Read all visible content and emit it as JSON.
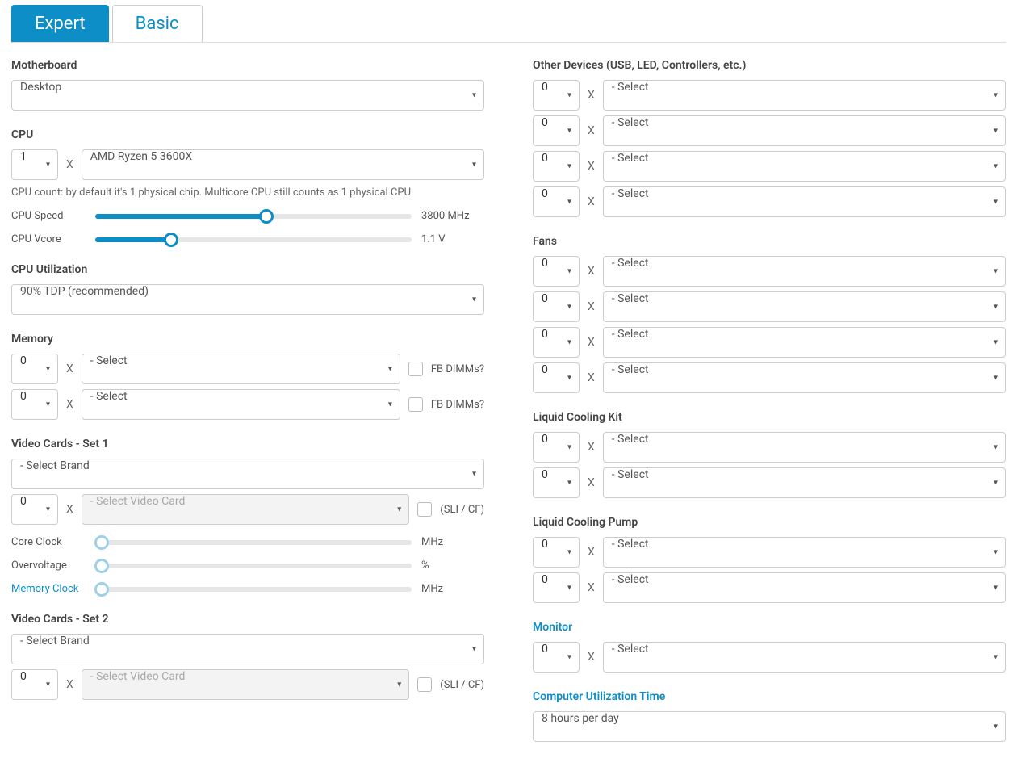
{
  "tabs": {
    "expert": "Expert",
    "basic": "Basic"
  },
  "left": {
    "motherboard": {
      "label": "Motherboard",
      "value": "Desktop"
    },
    "cpu": {
      "label": "CPU",
      "qty": "1",
      "value": "AMD Ryzen 5 3600X",
      "note": "CPU count: by default it's 1 physical chip. Multicore CPU still counts as 1 physical CPU.",
      "speed_label": "CPU Speed",
      "speed_value": "3800 MHz",
      "vcore_label": "CPU Vcore",
      "vcore_value": "1.1 V"
    },
    "cpu_util": {
      "label": "CPU Utilization",
      "value": "90% TDP (recommended)"
    },
    "memory": {
      "label": "Memory",
      "rows": [
        {
          "qty": "0",
          "value": "- Select",
          "fb": "FB DIMMs?"
        },
        {
          "qty": "0",
          "value": "- Select",
          "fb": "FB DIMMs?"
        }
      ]
    },
    "vcard1": {
      "label": "Video Cards - Set 1",
      "brand": "- Select Brand",
      "qty": "0",
      "card": "- Select Video Card",
      "sli": "(SLI / CF)",
      "core_clock_label": "Core Clock",
      "core_clock_unit": "MHz",
      "overvolt_label": "Overvoltage",
      "overvolt_unit": "%",
      "memclock_label": "Memory Clock",
      "memclock_unit": "MHz"
    },
    "vcard2": {
      "label": "Video Cards - Set 2",
      "brand": "- Select Brand",
      "qty": "0",
      "card": "- Select Video Card",
      "sli": "(SLI / CF)"
    }
  },
  "right": {
    "other": {
      "label": "Other Devices (USB, LED, Controllers, etc.)",
      "rows": [
        {
          "qty": "0",
          "value": "- Select"
        },
        {
          "qty": "0",
          "value": "- Select"
        },
        {
          "qty": "0",
          "value": "- Select"
        },
        {
          "qty": "0",
          "value": "- Select"
        }
      ]
    },
    "fans": {
      "label": "Fans",
      "rows": [
        {
          "qty": "0",
          "value": "- Select"
        },
        {
          "qty": "0",
          "value": "- Select"
        },
        {
          "qty": "0",
          "value": "- Select"
        },
        {
          "qty": "0",
          "value": "- Select"
        }
      ]
    },
    "lck": {
      "label": "Liquid Cooling Kit",
      "rows": [
        {
          "qty": "0",
          "value": "- Select"
        },
        {
          "qty": "0",
          "value": "- Select"
        }
      ]
    },
    "lcp": {
      "label": "Liquid Cooling Pump",
      "rows": [
        {
          "qty": "0",
          "value": "- Select"
        },
        {
          "qty": "0",
          "value": "- Select"
        }
      ]
    },
    "monitor": {
      "label": "Monitor",
      "rows": [
        {
          "qty": "0",
          "value": "- Select"
        }
      ]
    },
    "util_time": {
      "label": "Computer Utilization Time",
      "value": "8 hours per day"
    }
  }
}
